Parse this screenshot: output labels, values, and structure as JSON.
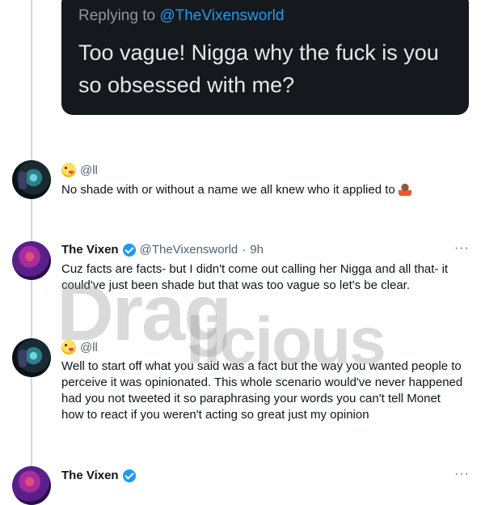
{
  "quoted_tweet": {
    "replying_prefix": "Replying to",
    "replying_handle": "@TheVixensworld",
    "text": "Too vague! Nigga why the fuck is you so obsessed with me?"
  },
  "tweets": [
    {
      "avatar": "dark-avatar",
      "name_handle": "@ll",
      "text": "No shade with or without a name we all knew who it applied to",
      "emoji": "shrug-emoji"
    },
    {
      "avatar": "purple-avatar",
      "name": "The Vixen",
      "handle": "@TheVixensworld",
      "separator": "·",
      "time": "9h",
      "more": "···",
      "text": "Cuz facts are facts- but I didn't come out calling her Nigga and all that- it could've just been shade but that was too vague so let's be clear."
    },
    {
      "avatar": "dark-avatar",
      "name_handle": "@ll",
      "text": "Well to start off what you said was a fact but the way you wanted people to perceive it was opinionated. This whole scenario would've never happened had you not tweeted it so paraphrasing your words you can't tell Monet how to react if you weren't acting so great just my opinion"
    },
    {
      "avatar": "purple-avatar",
      "name": "The Vixen",
      "more": "···"
    }
  ],
  "watermark": {
    "line1": "Drag",
    "line2": "licious"
  },
  "colors": {
    "verified": "#1d9bf0",
    "dark_card": "#15181c",
    "thread_line": "#cfd9de"
  }
}
